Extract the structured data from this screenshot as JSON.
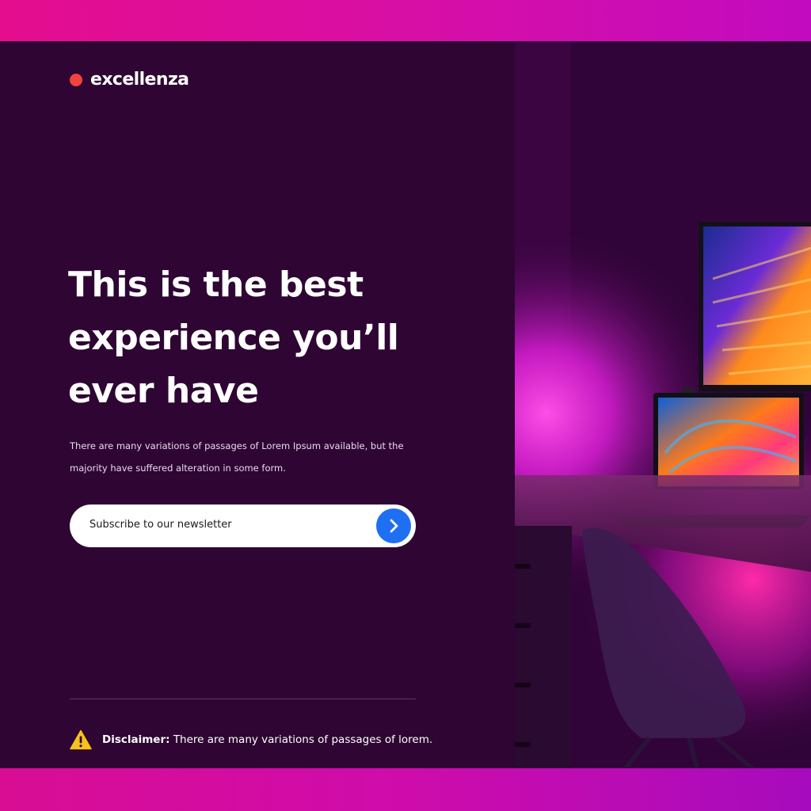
{
  "brand": {
    "logo_text": "excellenza",
    "dot_color": "#f2433f"
  },
  "hero": {
    "headline_lines": [
      "This is the best",
      "experience you’ll",
      "ever have"
    ],
    "description_lines": [
      "There are many variations of passages of Lorem Ipsum available, but the",
      "majority have suffered alteration in some form."
    ]
  },
  "newsletter": {
    "placeholder": "Subscribe to our newsletter",
    "submit_icon": "chevron-right-icon",
    "button_color": "#1f6ff2"
  },
  "disclaimer": {
    "label": "Disclaimer:",
    "text": "There are many variations of passages of lorem.",
    "icon": "warning-icon",
    "icon_color": "#f7c21a"
  },
  "colors": {
    "panel_bg": "#2e0533",
    "frame_accent": "#e0108f"
  }
}
